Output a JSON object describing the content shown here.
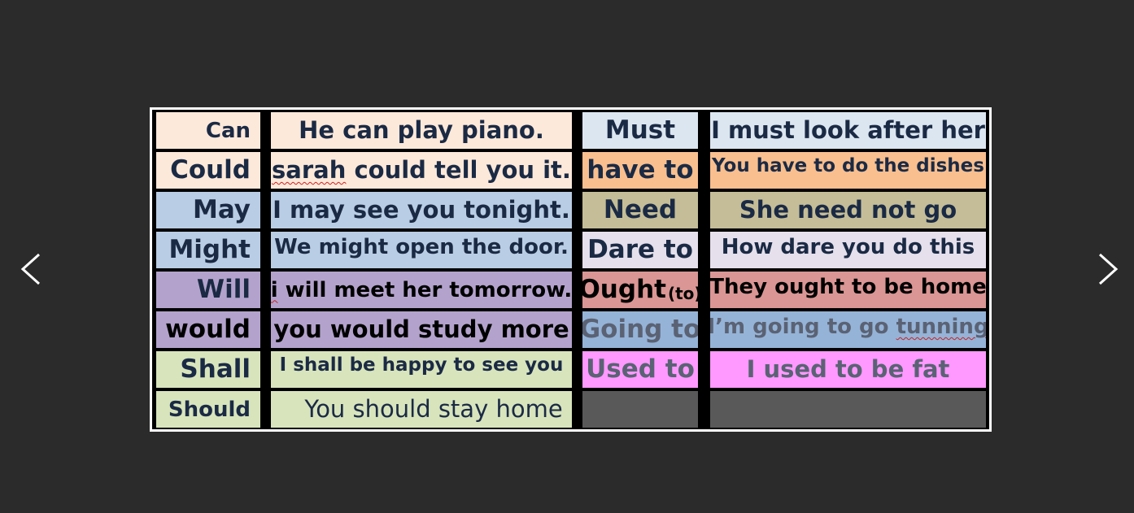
{
  "navigation": {
    "prev_icon": "chevron-left-icon",
    "next_icon": "chevron-right-icon"
  },
  "colors": {
    "background": "#2b2b2b",
    "peach": "#fde9da",
    "blue": "#b9cde4",
    "purple": "#b3a3cc",
    "green": "#d8e4bc",
    "light_blue": "#dce6f1",
    "orange": "#f9bf8f",
    "khaki": "#c4bd97",
    "lavender": "#e5e0ec",
    "salmon": "#da9694",
    "steel_blue": "#95b3d7",
    "pink": "#ff99ff",
    "dark_grey": "#595959"
  },
  "table": {
    "rows": [
      {
        "modal": "Can",
        "example": "He can play piano.",
        "modal2": "Must",
        "example2": "I must look after her"
      },
      {
        "modal": "Could",
        "example_misspelt": "sarah",
        "example_rest": " could tell you it.",
        "modal2": "have to",
        "example2": "You have to do the dishes"
      },
      {
        "modal": "May",
        "example": "I may see you tonight.",
        "modal2": "Need",
        "example2": "She need not go"
      },
      {
        "modal": "Might",
        "example": "We might open the door.",
        "modal2": "Dare to",
        "example2": "How dare you do this"
      },
      {
        "modal": "Will",
        "example_misspelt": "i",
        "example_rest": " will meet her tomorrow.",
        "modal2": "Ought",
        "modal2_suffix": "(to)",
        "example2": "They ought to be home"
      },
      {
        "modal": "would",
        "example": "you would study more",
        "modal2": "Going to",
        "example2_start": "I’m going to go ",
        "example2_misspelt": "tunning"
      },
      {
        "modal": "Shall",
        "example": "I shall be happy to see you",
        "modal2": "Used to",
        "example2": "I used to be fat"
      },
      {
        "modal": "Should",
        "example": "You should stay home",
        "modal2": "",
        "example2": ""
      }
    ]
  }
}
